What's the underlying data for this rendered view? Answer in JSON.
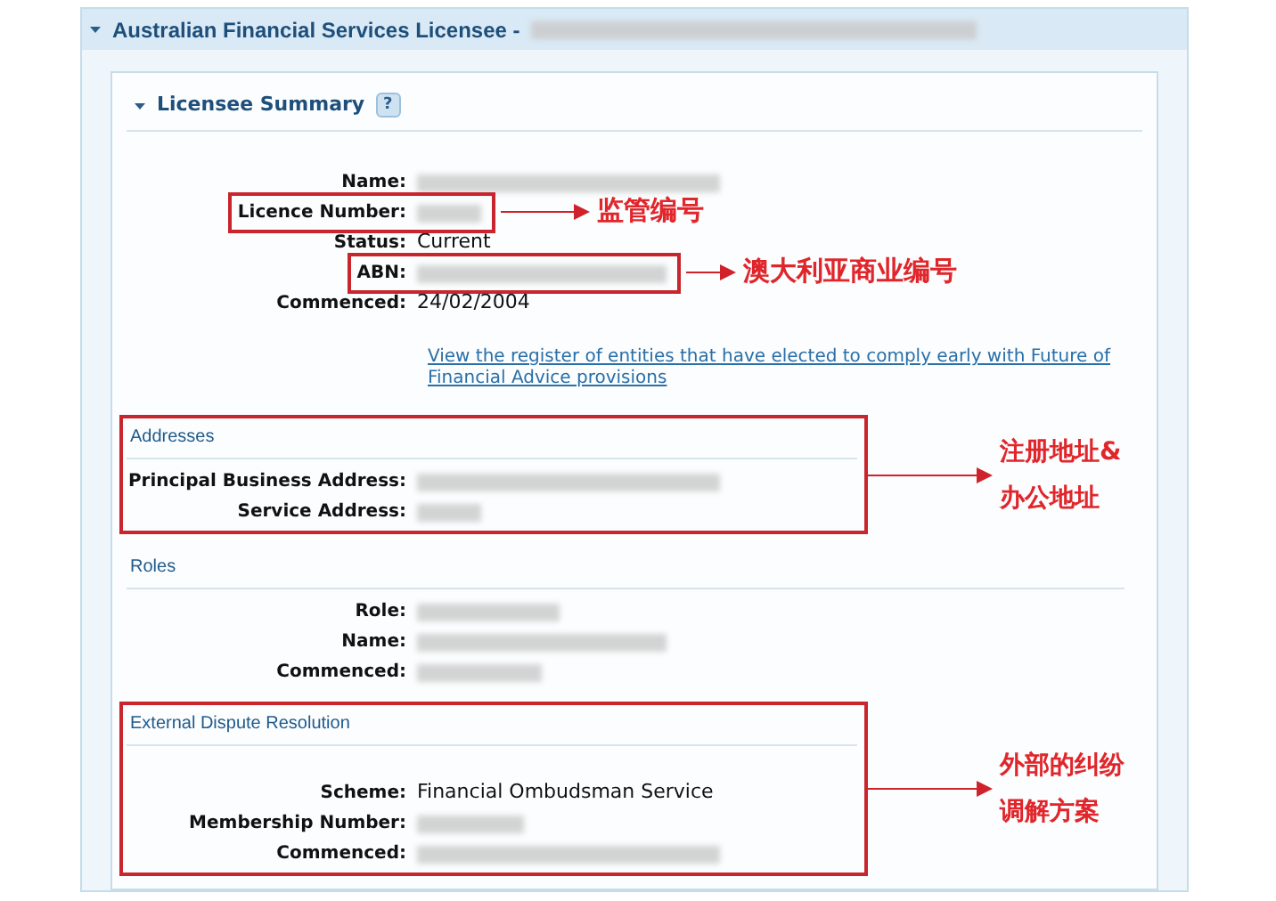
{
  "header": {
    "title": "Australian Financial Services Licensee -",
    "expanded": true,
    "name_redacted": true
  },
  "summary": {
    "title": "Licensee Summary",
    "help": "?",
    "expanded": true,
    "fields": [
      {
        "label": "Name:",
        "redacted": true,
        "highlighted": false
      },
      {
        "label": "Licence Number:",
        "redacted": true,
        "highlighted": true,
        "annotation": "监管编号"
      },
      {
        "label": "Status:",
        "value": "Current",
        "redacted": false,
        "highlighted": false
      },
      {
        "label": "ABN:",
        "redacted": true,
        "highlighted": true,
        "annotation": "澳大利亚商业编号"
      },
      {
        "label": "Commenced:",
        "value": "24/02/2004",
        "redacted": false,
        "highlighted": false
      }
    ],
    "link": "View the register of entities that have elected to comply early with Future of Financial Advice provisions"
  },
  "sections": [
    {
      "title": "Addresses",
      "highlighted": true,
      "annotation": "注册地址&办公地址",
      "fields": [
        {
          "label": "Principal Business Address:",
          "redacted": true
        },
        {
          "label": "Service Address:",
          "redacted": true
        }
      ]
    },
    {
      "title": "Roles",
      "highlighted": false,
      "fields": [
        {
          "label": "Role:",
          "redacted": true
        },
        {
          "label": "Name:",
          "redacted": true
        },
        {
          "label": "Commenced:",
          "redacted": true
        }
      ]
    },
    {
      "title": "External Dispute Resolution",
      "highlighted": true,
      "annotation": "外部的纠纷调解方案",
      "fields": [
        {
          "label": "Scheme:",
          "value": "Financial Ombudsman Service",
          "redacted": false
        },
        {
          "label": "Membership Number:",
          "redacted": true
        },
        {
          "label": "Commenced:",
          "redacted": true
        }
      ]
    }
  ]
}
